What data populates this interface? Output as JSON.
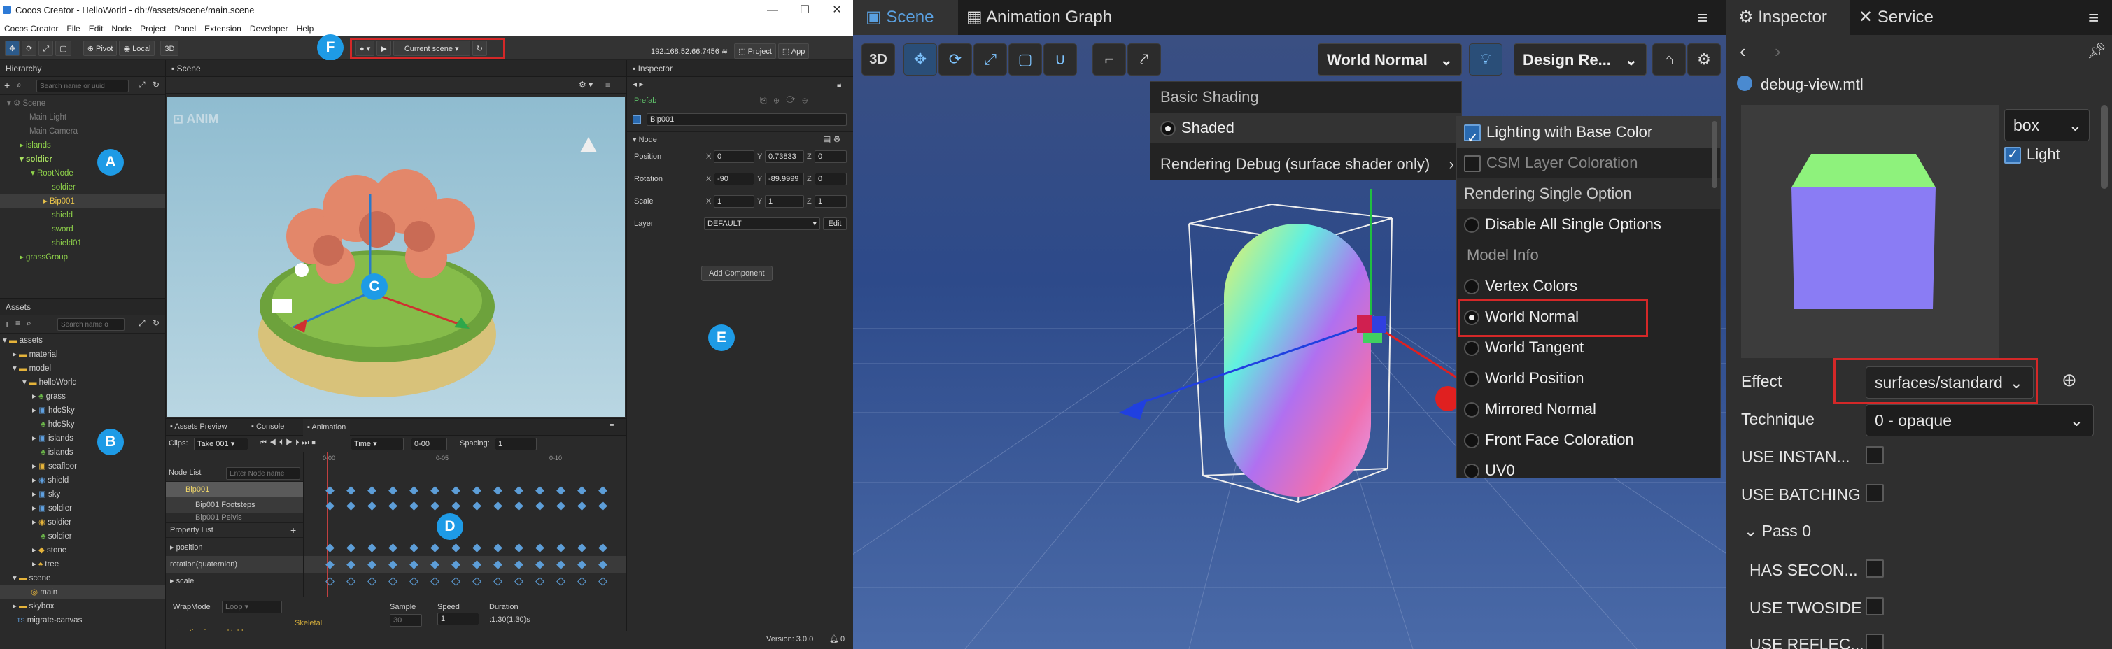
{
  "left": {
    "title": "Cocos Creator - HelloWorld - db://assets/scene/main.scene",
    "window_controls": [
      "—",
      "☐",
      "✕"
    ],
    "menu": [
      "Cocos Creator",
      "File",
      "Edit",
      "Node",
      "Project",
      "Panel",
      "Extension",
      "Developer",
      "Help"
    ],
    "toolbar": {
      "pivot": "Pivot",
      "local": "Local",
      "mode3d": "3D",
      "scene_select": "Current scene",
      "ip": "192.168.52.66:7456",
      "project": "Project",
      "app": "App"
    },
    "hierarchy": {
      "tab": "Hierarchy",
      "search_placeholder": "Search name or uuid",
      "items": [
        "Scene",
        "Main Light",
        "Main Camera",
        "islands",
        "soldier",
        "RootNode",
        "soldier",
        "Bip001",
        "shield",
        "sword",
        "shield01",
        "grassGroup"
      ]
    },
    "assets": {
      "tab": "Assets",
      "search_placeholder": "Search name o",
      "items": [
        "assets",
        "material",
        "model",
        "helloWorld",
        "grass",
        "hdcSky",
        "hdcSky",
        "islands",
        "islands",
        "seafloor",
        "shield",
        "sky",
        "soldier",
        "soldier",
        "soldier",
        "stone",
        "tree",
        "scene",
        "main",
        "skybox",
        "migrate-canvas"
      ]
    },
    "scene": {
      "tab": "Scene"
    },
    "inspector": {
      "tab": "Inspector",
      "prefab_label": "Prefab",
      "node_name": "Bip001",
      "node_section": "Node",
      "position_label": "Position",
      "pos_x": "0",
      "pos_y": "0.73833",
      "pos_z": "0",
      "rotation_label": "Rotation",
      "rot_x": "-90",
      "rot_y": "-89.9999",
      "rot_z": "0",
      "scale_label": "Scale",
      "sc_x": "1",
      "sc_y": "1",
      "sc_z": "1",
      "layer_label": "Layer",
      "layer_value": "DEFAULT",
      "edit": "Edit",
      "add_component": "Add Component"
    },
    "bottom": {
      "tabs": [
        "Assets Preview",
        "Console",
        "Animation"
      ],
      "clips_label": "Clips:",
      "clip_value": "Take 001",
      "time_mode": "Time",
      "time_value": "0-00",
      "spacing_label": "Spacing:",
      "spacing_value": "1",
      "ticks": [
        "0-00",
        "0-05",
        "0-10"
      ],
      "node_list_label": "Node List",
      "node_search_placeholder": "Enter Node name",
      "nodes": [
        "Bip001",
        "Bip001 Footsteps",
        "Bip001 Pelvis"
      ],
      "property_list_label": "Property List",
      "properties": [
        "position",
        "rotation(quaternion)",
        "scale"
      ],
      "wrapmode_label": "WrapMode",
      "wrapmode_value": "Loop",
      "warning": "Skeletal animation is uneditable",
      "sample_label": "Sample",
      "sample_value": "30",
      "speed_label": "Speed",
      "speed_value": "1",
      "duration_label": "Duration",
      "duration_value": ":1.30(1.30)s"
    },
    "version": "Version: 3.0.0",
    "notif_count": "0",
    "badges": [
      "A",
      "B",
      "C",
      "D",
      "E",
      "F"
    ]
  },
  "middle": {
    "tabs": [
      "Scene",
      "Animation Graph"
    ],
    "mode": "3D",
    "world_normal_dd": "World Normal",
    "design_dd": "Design Re...",
    "shading_menu": {
      "header": "Basic Shading",
      "shaded": "Shaded",
      "rendering_debug": "Rendering Debug (surface shader only)"
    },
    "debug_menu": {
      "lighting_base": "Lighting with Base Color",
      "csm": "CSM Layer Coloration",
      "single_header": "Rendering Single Option",
      "disable_all": "Disable All Single Options",
      "model_info": "Model Info",
      "options": [
        "Vertex Colors",
        "World Normal",
        "World Tangent",
        "World Position",
        "Mirrored Normal",
        "Front Face Coloration",
        "UV0"
      ]
    }
  },
  "right": {
    "tabs": [
      "Inspector",
      "Service"
    ],
    "file": "debug-view.mtl",
    "preview_mesh": "box",
    "light_label": "Light",
    "effect_label": "Effect",
    "effect_value": "surfaces/standard",
    "technique_label": "Technique",
    "technique_value": "0 - opaque",
    "use_instancing": "USE INSTAN...",
    "use_batching": "USE BATCHING",
    "pass_label": "Pass 0",
    "has_second": "HAS SECON...",
    "use_twoside": "USE TWOSIDE",
    "use_reflect": "USE REFLEC..."
  },
  "colors": {
    "accent": "#1e9be6",
    "highlight_red": "#d42828",
    "green_text": "#8ed14a"
  }
}
